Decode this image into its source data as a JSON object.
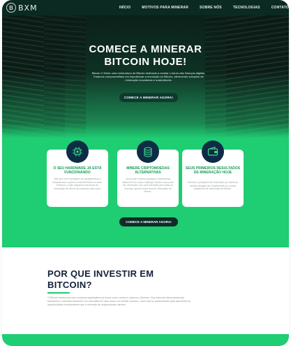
{
  "header": {
    "logo_mark": "B",
    "logo_text": "BXM",
    "nav": [
      "INÍCIO",
      "MOTIVOS PARA MINERAR",
      "SOBRE NÓS",
      "TECNOLOGIAS",
      "CONTATO"
    ]
  },
  "hero": {
    "title_line1": "COMECE A MINERAR",
    "title_line2": "BITCOIN HOJE!",
    "description": "Bitcoin X Miner uma mineradora de Bitcoin dedicada a moldar o futuro das finanças digitais. Estamos comprometidos em impulsionar a revolução do Bitcoin, oferecendo soluções de mineração inovadoras e sustentáveis.",
    "cta": "COMECE A MINERAR AGORA!"
  },
  "cards": [
    {
      "icon": "chip-icon",
      "title": "O SEU HARDWARE JÁ ESTÁ FUNCIONANDO",
      "text": "Não tem com montagem de equipamentos e infraestrutura: quando a transferência em suas. Estamos o mais alugamos harcitures de mineração de bitcoin funcionando para você."
    },
    {
      "icon": "coins-icon",
      "title": "MINERE CRIPTOMOEDAS ALTERNATIVAS",
      "text": "Você pode minerar quaisquer criptomoeda disponível em nosso catálogo! Nossa cross pode ser mineração, seu pool hashrate para todas as moedas, aponte numa taxa de mineração de bitcoin."
    },
    {
      "icon": "wallet-icon",
      "title": "SEUS PRIMEIROS RESULTADOS DE MINERAÇÃO HOJE",
      "text": "Receba e pretações de mineração por conta de carteira atingida da. Experimente já a nossa plataforma de mineração de bitcoin."
    }
  ],
  "green_cta": "COMECE A MINERAR AGORA!",
  "why": {
    "title_line1": "POR QUE INVESTIR EM",
    "title_line2": "BITCOIN?",
    "text": "O Bitcoin representa uma mudança significativa na forma como vemos e usamos o dinheiro. Sua natureza descentralizada transforma o mercado financeiro em uma ideia de valor única. Ao investir conosco, você está se posicionando para aproveitar as oportunidades emocionantes que o mercado de criptomoedas oferece."
  },
  "colors": {
    "accent_green": "#1fce72",
    "dark_navy": "#0e2c45",
    "header_bg": "#0a2a22"
  }
}
